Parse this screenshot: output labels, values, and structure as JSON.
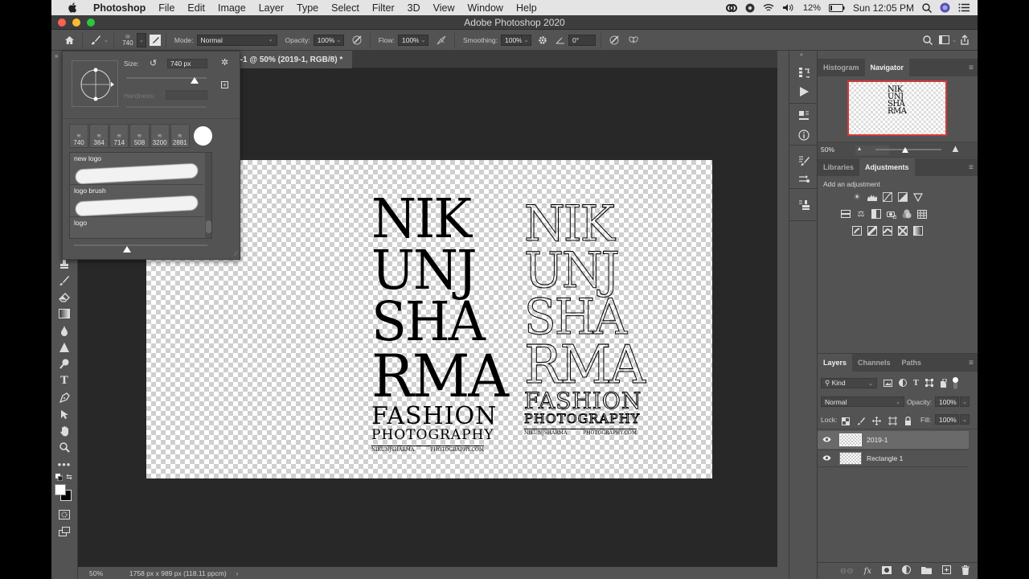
{
  "menubar": {
    "app": "Photoshop",
    "items": [
      "File",
      "Edit",
      "Image",
      "Layer",
      "Type",
      "Select",
      "Filter",
      "3D",
      "View",
      "Window",
      "Help"
    ],
    "status": {
      "battery": "12%",
      "clock": "Sun 12:05 PM"
    }
  },
  "window": {
    "title": "Adobe Photoshop 2020"
  },
  "options_bar": {
    "brush_size": "740",
    "mode_label": "Mode:",
    "mode_value": "Normal",
    "opacity_label": "Opacity:",
    "opacity_value": "100%",
    "flow_label": "Flow:",
    "flow_value": "100%",
    "smoothing_label": "Smoothing:",
    "smoothing_value": "100%",
    "angle_value": "0°"
  },
  "document": {
    "tab_title": "ed-1 @ 50% (2019-1, RGB/8) *",
    "zoom": "50%",
    "info": "1758 px x 989 px (118.11 ppcm)",
    "artwork": {
      "lines": [
        "NIK",
        "UNJ",
        "SHA",
        "RMA"
      ],
      "fashion": "FASHION",
      "photography": "PHOTOGRAPHY",
      "left_small": "NIKUNJSHARMA",
      "right_small": "PHOTOGRAPHY.COM"
    }
  },
  "brush_popup": {
    "size_label": "Size:",
    "size_value": "740 px",
    "hardness_label": "Hardness:",
    "size_slider_fraction": 0.85,
    "preview_slider_fraction": 0.4,
    "recent_sizes": [
      "740",
      "364",
      "714",
      "508",
      "3200",
      "2881"
    ],
    "presets": [
      {
        "name": "new logo"
      },
      {
        "name": "logo brush"
      },
      {
        "name": "logo"
      }
    ]
  },
  "navigator": {
    "tabs": [
      "Histogram",
      "Navigator"
    ],
    "active_tab": "Navigator",
    "zoom": "50%",
    "zoom_slider_fraction": 0.45
  },
  "adjustments": {
    "tabs": [
      "Libraries",
      "Adjustments"
    ],
    "active_tab": "Adjustments",
    "hint": "Add an adjustment"
  },
  "layers": {
    "tabs": [
      "Layers",
      "Channels",
      "Paths"
    ],
    "active_tab": "Layers",
    "filter_kind": "Kind",
    "blend_mode": "Normal",
    "opacity_label": "Opacity:",
    "opacity": "100%",
    "lock_label": "Lock:",
    "fill_label": "Fill:",
    "fill": "100%",
    "items": [
      {
        "name": "2019-1",
        "visible": true,
        "selected": true
      },
      {
        "name": "Rectangle 1",
        "visible": true,
        "selected": false
      }
    ]
  },
  "colors": {
    "foreground": "#ffffff",
    "background": "#000000",
    "navigator_frame": "#d03a3a"
  }
}
